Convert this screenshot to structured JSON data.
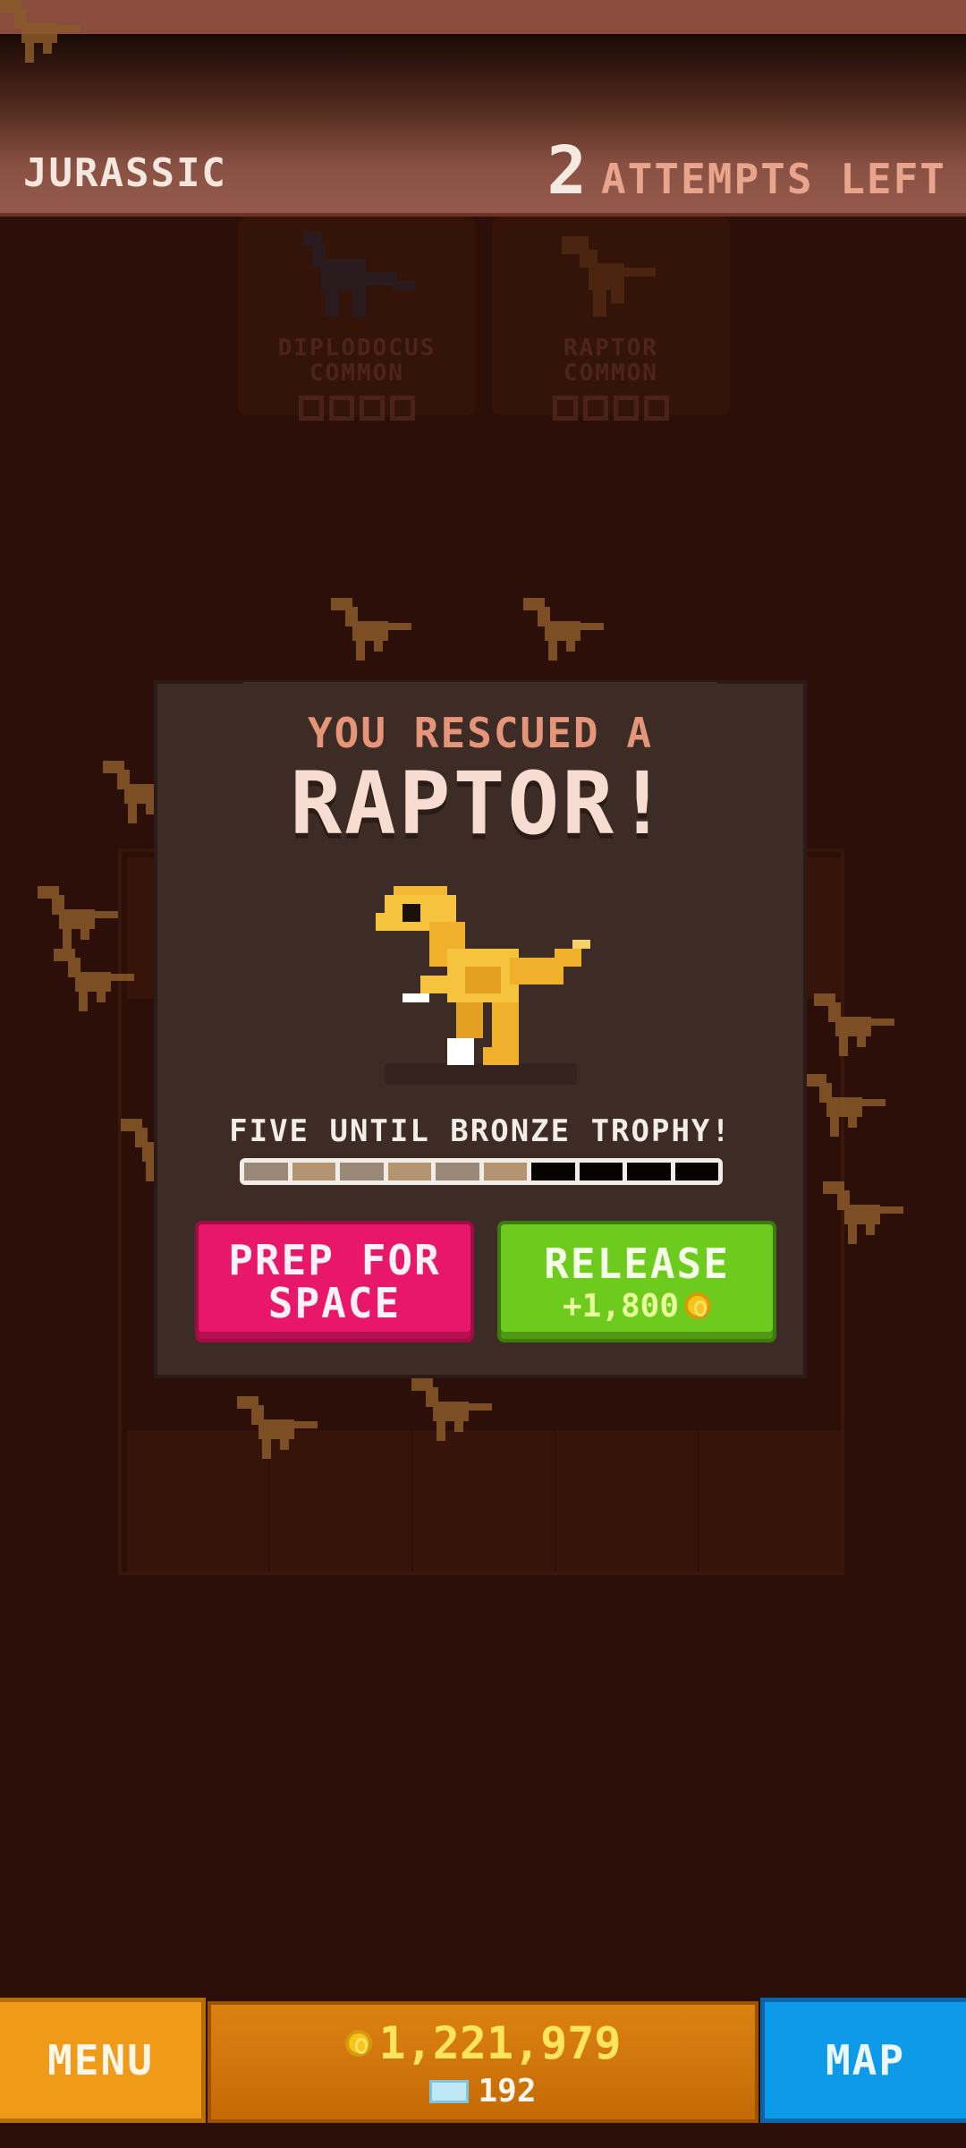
{
  "header": {
    "era": "JURASSIC",
    "attempts_count": "2",
    "attempts_label": "ATTEMPTS LEFT"
  },
  "collection": [
    {
      "name": "DIPLODOCUS",
      "rarity": "COMMON",
      "icon": "diplodocus-icon"
    },
    {
      "name": "RAPTOR",
      "rarity": "COMMON",
      "icon": "raptor-icon"
    }
  ],
  "popup": {
    "heading": "YOU RESCUED A",
    "dino_name": "RAPTOR!",
    "trophy_text": "FIVE UNTIL BRONZE TROPHY!",
    "progress": {
      "filled": 6,
      "total": 10
    },
    "prep_button": {
      "line1": "PREP FOR",
      "line2": "SPACE"
    },
    "release_button": {
      "label": "RELEASE",
      "reward": "+1,800"
    }
  },
  "bottom": {
    "menu_label": "MENU",
    "coins": "1,221,979",
    "gems": "192",
    "map_label": "MAP"
  },
  "colors": {
    "background": "#2c0f08",
    "panel": "#3d2b25",
    "prep": "#e8176a",
    "release": "#6ccb1c",
    "menu": "#f09a1a",
    "map": "#0d9be9",
    "coin": "#f5c518"
  }
}
